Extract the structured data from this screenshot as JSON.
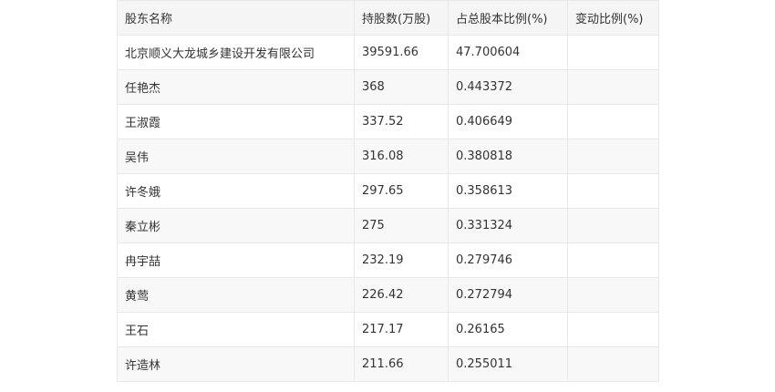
{
  "table": {
    "headers": [
      "股东名称",
      "持股数(万股)",
      "占总股本比例(%)",
      "变动比例(%)"
    ],
    "rows": [
      [
        "北京顺义大龙城乡建设开发有限公司",
        "39591.66",
        "47.700604",
        ""
      ],
      [
        "任艳杰",
        "368",
        "0.443372",
        ""
      ],
      [
        "王淑霞",
        "337.52",
        "0.406649",
        ""
      ],
      [
        "吴伟",
        "316.08",
        "0.380818",
        ""
      ],
      [
        "许冬娥",
        "297.65",
        "0.358613",
        ""
      ],
      [
        "秦立彬",
        "275",
        "0.331324",
        ""
      ],
      [
        "冉宇喆",
        "232.19",
        "0.279746",
        ""
      ],
      [
        "黄莺",
        "226.42",
        "0.272794",
        ""
      ],
      [
        "王石",
        "217.17",
        "0.26165",
        ""
      ],
      [
        "许造林",
        "211.66",
        "0.255011",
        ""
      ]
    ]
  }
}
